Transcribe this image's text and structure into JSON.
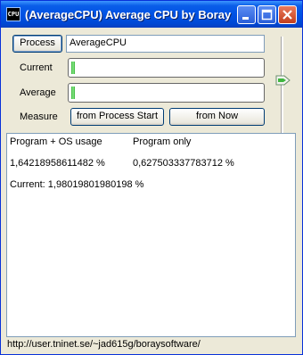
{
  "window": {
    "icon_text": "CPU",
    "title": "(AverageCPU) Average CPU by Boray"
  },
  "controls": {
    "process_button": "Process",
    "process_value": "AverageCPU",
    "current_label": "Current",
    "average_label": "Average",
    "measure_label": "Measure",
    "from_start_button": "from Process Start",
    "from_now_button": "from Now",
    "current_level": 0.02,
    "average_level": 0.02
  },
  "output": {
    "col1_header": "Program + OS usage",
    "col2_header": "Program only",
    "col1_value": "1,64218958611482 %",
    "col2_value": "0,627503337783712 %",
    "current_line": "Current: 1,98019801980198 %"
  },
  "status": {
    "url": "http://user.tninet.se/~jad615g/boraysoftware/"
  },
  "colors": {
    "titlebar": "#0052E5",
    "progress": "#2FB12F",
    "close_button": "#C23F1D"
  },
  "icons": [
    "app-cpu-icon",
    "minimize-icon",
    "maximize-icon",
    "close-icon",
    "slider-arrow-icon"
  ]
}
